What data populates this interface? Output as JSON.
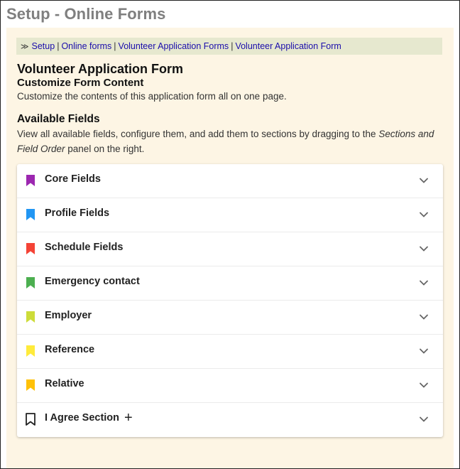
{
  "page": {
    "title": "Setup - Online Forms"
  },
  "breadcrumb": {
    "separator": "≫",
    "items": [
      "Setup",
      "Online forms",
      "Volunteer Application Forms",
      "Volunteer Application Form"
    ]
  },
  "form": {
    "title": "Volunteer Application Form",
    "subtitle": "Customize Form Content",
    "description": "Customize the contents of this application form all on one page."
  },
  "available_fields": {
    "heading": "Available Fields",
    "description_pre": "View all available fields, configure them, and add them to sections by dragging to the ",
    "description_em": "Sections and Field Order",
    "description_post": " panel on the right.",
    "sections": [
      {
        "label": "Core Fields",
        "color": "#9c27b0",
        "icon": "bookmark-icon"
      },
      {
        "label": "Profile Fields",
        "color": "#2196f3",
        "icon": "bookmark-icon"
      },
      {
        "label": "Schedule Fields",
        "color": "#f44336",
        "icon": "bookmark-icon"
      },
      {
        "label": "Emergency contact",
        "color": "#4caf50",
        "icon": "bookmark-icon"
      },
      {
        "label": "Employer",
        "color": "#cddc39",
        "icon": "bookmark-icon"
      },
      {
        "label": "Reference",
        "color": "#ffeb3b",
        "icon": "bookmark-icon"
      },
      {
        "label": "Relative",
        "color": "#ffc107",
        "icon": "bookmark-icon"
      },
      {
        "label": "I Agree Section",
        "color": "#222222",
        "icon": "bookmark-outline-icon",
        "add_icon": "plus-icon"
      }
    ]
  }
}
